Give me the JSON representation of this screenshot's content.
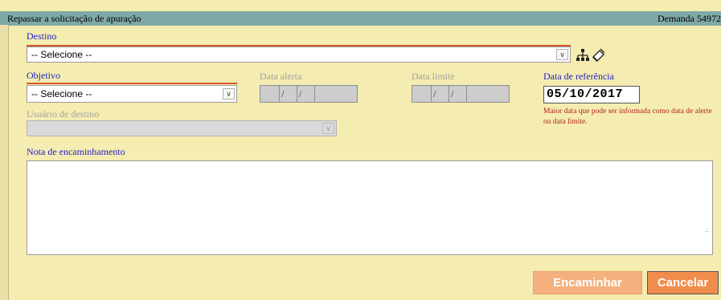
{
  "window": {
    "title": "Repassar a solicitação de apuração",
    "demand_label": "Demanda 54972"
  },
  "destino": {
    "label": "Destino",
    "value": "-- Selecione --"
  },
  "objetivo": {
    "label": "Objetivo",
    "value": "-- Selecione --"
  },
  "data_alerta": {
    "label": "Data alerta",
    "sep1": "/",
    "sep2": "/"
  },
  "data_limite": {
    "label": "Data limite",
    "sep1": "/",
    "sep2": "/"
  },
  "data_referencia": {
    "label": "Data de referência",
    "value": "05/10/2017",
    "note": "Maior data que pode ser informada como data de alerte ou data limite."
  },
  "usuario_destino": {
    "label": "Usuário de destino",
    "value": ""
  },
  "nota": {
    "label": "Nota de encaminhamento",
    "value": ""
  },
  "buttons": {
    "encaminhar": "Encaminhar",
    "cancelar": "Cancelar"
  },
  "icons": {
    "hierarchy": "hierarchy-icon",
    "clear": "eraser-icon"
  },
  "colors": {
    "background": "#f4ecb1",
    "label": "#2323c8",
    "note": "#b01e1e",
    "button_primary": "#f4b07e",
    "button_cancel": "#f08d4d",
    "titlebar": "#7fa9a8"
  }
}
